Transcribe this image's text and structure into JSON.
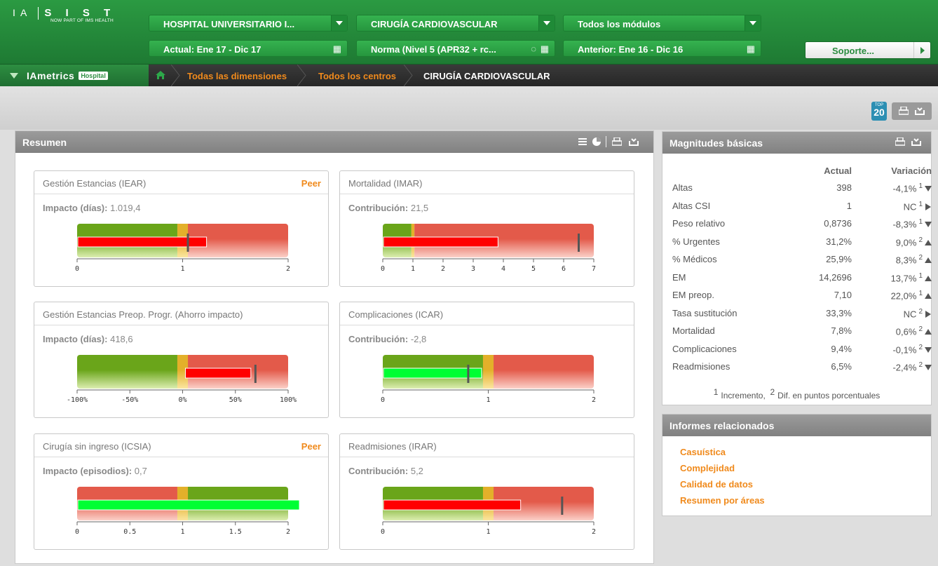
{
  "logo": {
    "left": "I A",
    "brand": "S I S T",
    "tagline": "NOW PART OF IMS HEALTH"
  },
  "selectors": {
    "hospital": "HOSPITAL UNIVERSITARIO I...",
    "service": "CIRUGÍA CARDIOVASCULAR",
    "modules": "Todos los módulos",
    "current_period": "Actual: Ene 17 - Dic 17",
    "norm": "Norma (Nivel 5 (APR32 + rc...",
    "previous_period": "Anterior: Ene 16 - Dic 16"
  },
  "support": {
    "label": "Soporte..."
  },
  "breadcrumb": {
    "app_name": "IAmetrics",
    "app_badge": "Hospital",
    "items": [
      "Todas las dimensiones",
      "Todos los centros",
      "CIRUGÍA CARDIOVASCULAR"
    ]
  },
  "toolbar": {
    "top_badge_small": "TOP",
    "top_badge_num": "20"
  },
  "resumen": {
    "title": "Resumen",
    "cards": [
      {
        "title": "Gestión Estancias (IEAR)",
        "peer": "Peer",
        "metric_label": "Impacto (días):",
        "metric_value": "1.019,4",
        "ticks": [
          "0",
          "1",
          "2"
        ],
        "bar_value": 1.22,
        "marker": 1.05,
        "min": 0,
        "max": 2,
        "zones": [
          [
            "green",
            0,
            0.95
          ],
          [
            "yellow",
            0.95,
            1.05
          ],
          [
            "red",
            1.05,
            2
          ]
        ],
        "bar_color": "#ff0000"
      },
      {
        "title": "Mortalidad (IMAR)",
        "peer": "",
        "metric_label": "Contribución:",
        "metric_value": "21,5",
        "ticks": [
          "0",
          "1",
          "2",
          "3",
          "4",
          "5",
          "6",
          "7"
        ],
        "bar_value": 3.8,
        "marker": 6.5,
        "min": 0,
        "max": 7,
        "zones": [
          [
            "green",
            0,
            0.95
          ],
          [
            "yellow",
            0.95,
            1.05
          ],
          [
            "red",
            1.05,
            7
          ]
        ],
        "bar_color": "#ff0000"
      },
      {
        "title": "Gestión Estancias Preop. Progr. (Ahorro impacto)",
        "peer": "",
        "metric_label": "Impacto (días):",
        "metric_value": "418,6",
        "ticks": [
          "-100%",
          "-50%",
          "0%",
          "50%",
          "100%"
        ],
        "bar_start": 0.02,
        "bar_value": 0.64,
        "marker": 0.69,
        "min": -1,
        "max": 1,
        "zones": [
          [
            "green",
            -1,
            -0.05
          ],
          [
            "yellow",
            -0.05,
            0.05
          ],
          [
            "red",
            0.05,
            1
          ]
        ],
        "bar_color": "#ff0000"
      },
      {
        "title": "Complicaciones (ICAR)",
        "peer": "",
        "metric_label": "Contribución:",
        "metric_value": "-2,8",
        "ticks": [
          "0",
          "1",
          "2"
        ],
        "bar_value": 0.93,
        "marker": 0.81,
        "min": 0,
        "max": 2,
        "zones": [
          [
            "green",
            0,
            0.95
          ],
          [
            "yellow",
            0.95,
            1.05
          ],
          [
            "red",
            1.05,
            2
          ]
        ],
        "bar_color": "#00ff33"
      },
      {
        "title": "Cirugía sin ingreso (ICSIA)",
        "peer": "Peer",
        "metric_label": "Impacto (episodios):",
        "metric_value": "0,7",
        "ticks": [
          "0",
          "0.5",
          "1",
          "1.5",
          "2"
        ],
        "bar_value": 2.1,
        "marker": null,
        "min": 0,
        "max": 2,
        "zones": [
          [
            "red",
            0,
            0.95
          ],
          [
            "yellow",
            0.95,
            1.05
          ],
          [
            "green",
            1.05,
            2
          ]
        ],
        "bar_color": "#00ff33"
      },
      {
        "title": "Readmisiones (IRAR)",
        "peer": "",
        "metric_label": "Contribución:",
        "metric_value": "5,2",
        "ticks": [
          "0",
          "1",
          "2"
        ],
        "bar_value": 1.3,
        "marker": 1.7,
        "min": 0,
        "max": 2,
        "zones": [
          [
            "green",
            0,
            0.95
          ],
          [
            "yellow",
            0.95,
            1.05
          ],
          [
            "red",
            1.05,
            2
          ]
        ],
        "bar_color": "#ff0000"
      }
    ]
  },
  "magnitudes": {
    "title": "Magnitudes básicas",
    "col_actual": "Actual",
    "col_var": "Variación",
    "rows": [
      {
        "name": "Altas",
        "actual": "398",
        "var": "-4,1%",
        "sup": "1",
        "dir": "down"
      },
      {
        "name": "Altas CSI",
        "actual": "1",
        "var": "NC",
        "sup": "1",
        "dir": "right"
      },
      {
        "name": "Peso relativo",
        "actual": "0,8736",
        "var": "-8,3%",
        "sup": "1",
        "dir": "down"
      },
      {
        "name": "% Urgentes",
        "actual": "31,2%",
        "var": "9,0%",
        "sup": "2",
        "dir": "up"
      },
      {
        "name": "% Médicos",
        "actual": "25,9%",
        "var": "8,3%",
        "sup": "2",
        "dir": "up"
      },
      {
        "name": "EM",
        "actual": "14,2696",
        "var": "13,7%",
        "sup": "1",
        "dir": "up"
      },
      {
        "name": "EM preop.",
        "actual": "7,10",
        "var": "22,0%",
        "sup": "1",
        "dir": "up"
      },
      {
        "name": "Tasa sustitución",
        "actual": "33,3%",
        "var": "NC",
        "sup": "2",
        "dir": "right"
      },
      {
        "name": "Mortalidad",
        "actual": "7,8%",
        "var": "0,6%",
        "sup": "2",
        "dir": "up"
      },
      {
        "name": "Complicaciones",
        "actual": "9,4%",
        "var": "-0,1%",
        "sup": "2",
        "dir": "down"
      },
      {
        "name": "Readmisiones",
        "actual": "6,5%",
        "var": "-2,4%",
        "sup": "2",
        "dir": "down"
      }
    ],
    "legend_1": "Incremento,",
    "legend_2": "Dif. en puntos porcentuales"
  },
  "informes": {
    "title": "Informes relacionados",
    "links": [
      "Casuística",
      "Complejidad",
      "Calidad de datos",
      "Resumen por áreas"
    ]
  },
  "colors": {
    "green_header": "#26963e",
    "orange": "#f08a1c",
    "gray_header": "#8c8c8c"
  }
}
